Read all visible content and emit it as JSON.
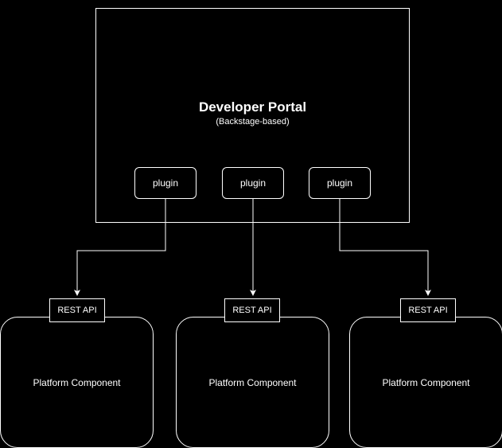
{
  "portal": {
    "title": "Developer Portal",
    "subtitle": "(Backstage-based)"
  },
  "plugins": [
    {
      "label": "plugin"
    },
    {
      "label": "plugin"
    },
    {
      "label": "plugin"
    }
  ],
  "apis": [
    {
      "label": "REST API"
    },
    {
      "label": "REST API"
    },
    {
      "label": "REST API"
    }
  ],
  "components": [
    {
      "label": "Platform Component"
    },
    {
      "label": "Platform Component"
    },
    {
      "label": "Platform Component"
    }
  ]
}
